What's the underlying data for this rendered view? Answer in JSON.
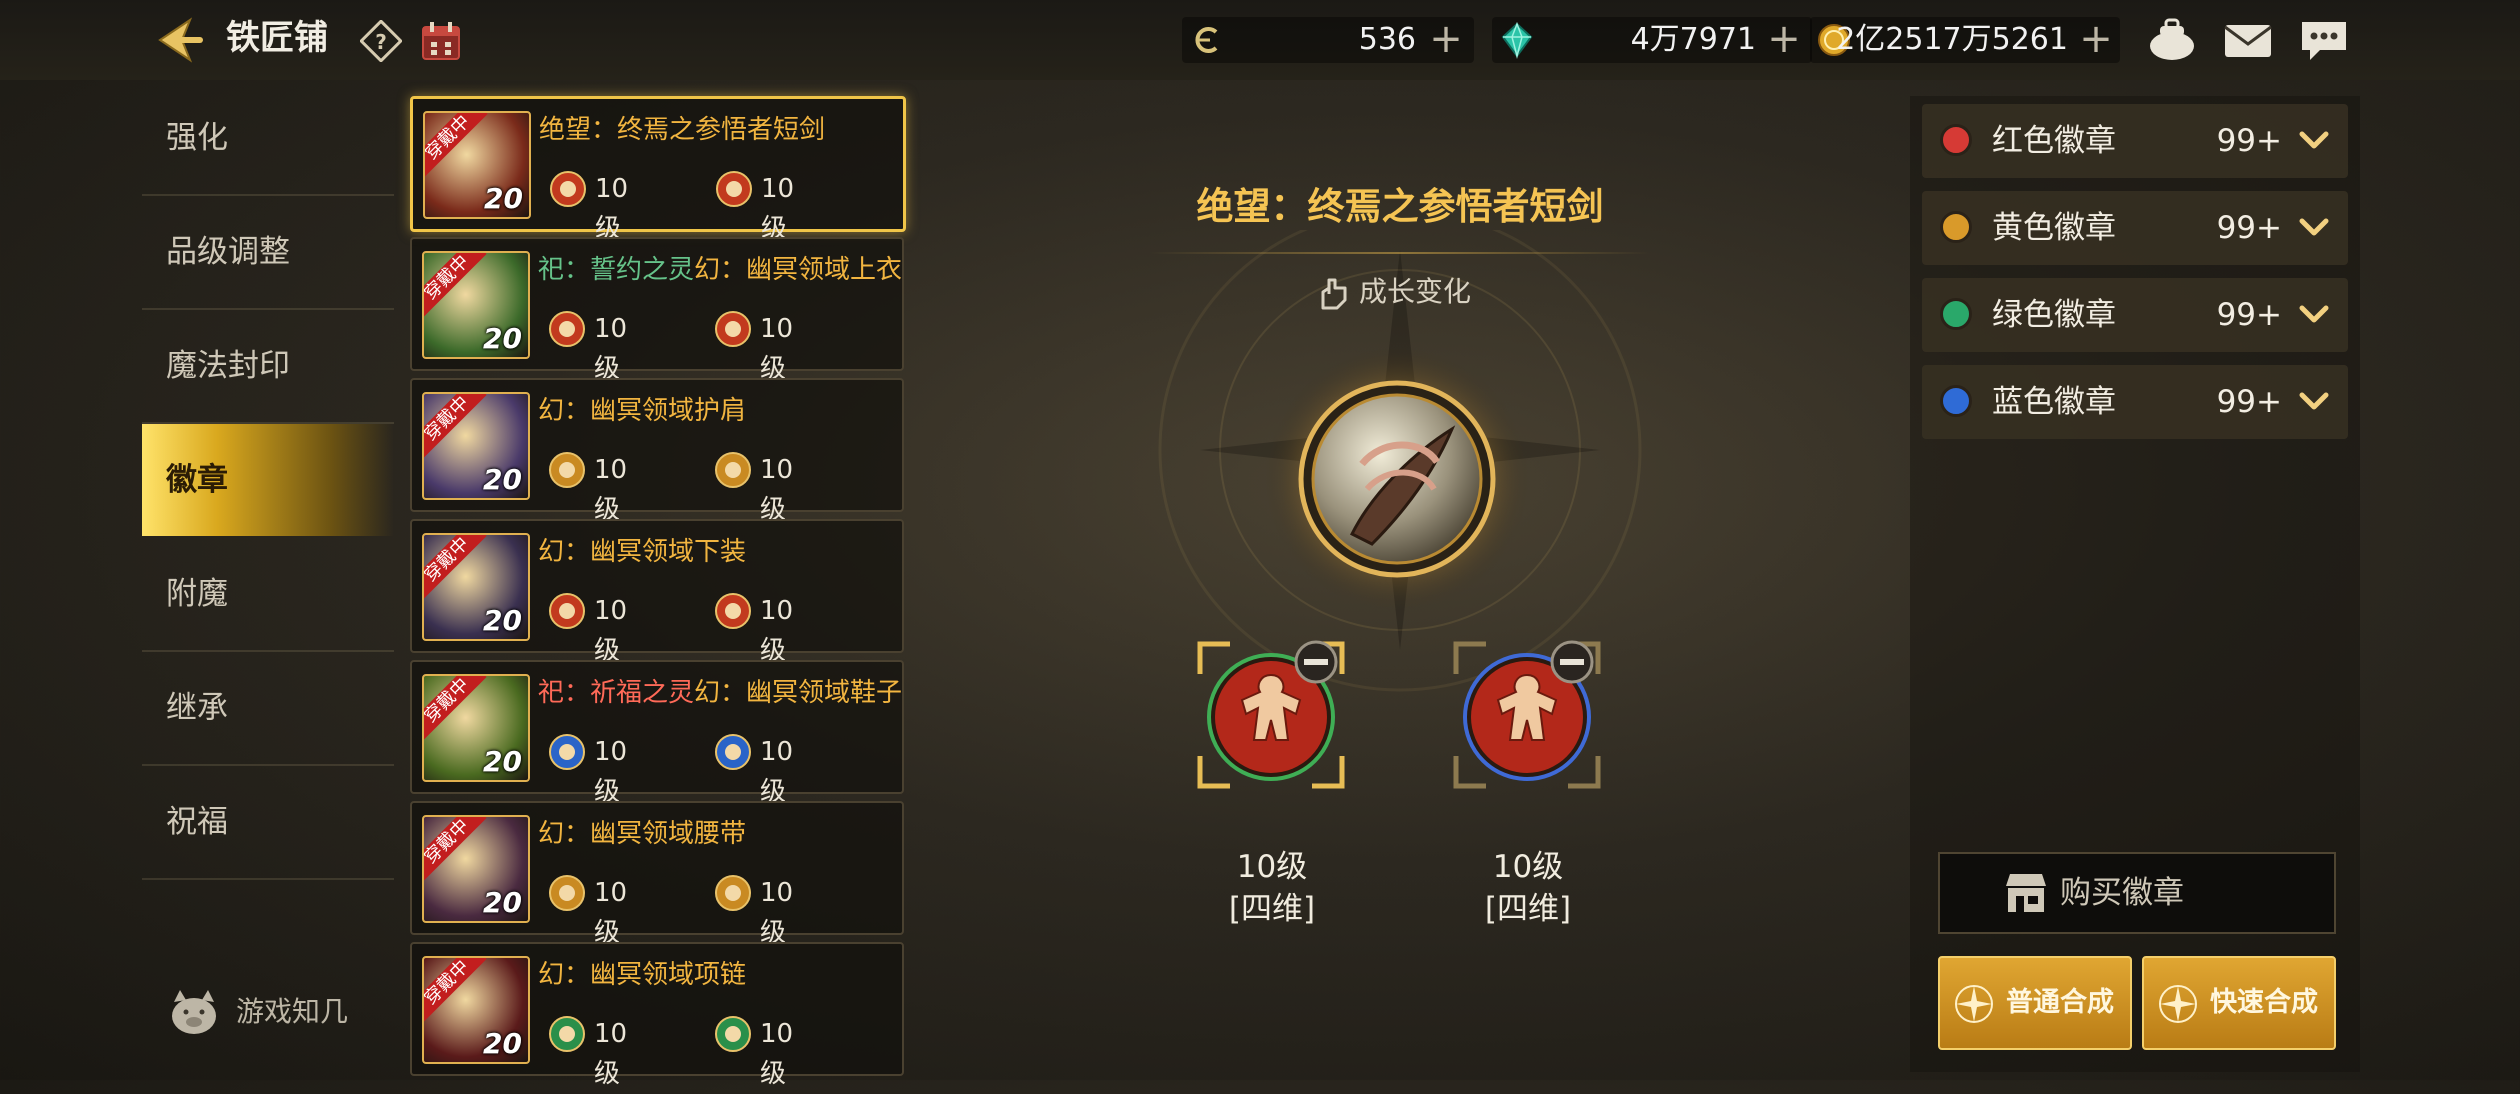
{
  "header": {
    "title": "铁匠铺",
    "currencies": [
      {
        "icon": "coin-c-icon",
        "value": "536"
      },
      {
        "icon": "crystal-icon",
        "value": "4万7971"
      },
      {
        "icon": "gold-coin-icon",
        "value": "2亿2517万5261"
      }
    ]
  },
  "nav": {
    "items": [
      {
        "label": "强化"
      },
      {
        "label": "品级调整"
      },
      {
        "label": "魔法封印"
      },
      {
        "label": "徽章",
        "active": true
      },
      {
        "label": "附魔"
      },
      {
        "label": "继承"
      },
      {
        "label": "祝福"
      }
    ],
    "footer_label": "游戏知几"
  },
  "equipment": [
    {
      "prefix": "",
      "name": "绝望：终焉之参悟者短剑",
      "tag": "穿戴中",
      "level": "20",
      "slot1": "10级",
      "slot2": "10级",
      "emblem": "red",
      "selected": true
    },
    {
      "prefix": "祀：誓约之灵",
      "name": "幻：幽冥领域上衣",
      "tag": "穿戴中",
      "level": "20",
      "slot1": "10级",
      "slot2": "10级",
      "emblem": "red"
    },
    {
      "prefix": "",
      "name": "幻：幽冥领域护肩",
      "tag": "穿戴中",
      "level": "20",
      "slot1": "10级",
      "slot2": "10级",
      "emblem": "yellow"
    },
    {
      "prefix": "",
      "name": "幻：幽冥领域下装",
      "tag": "穿戴中",
      "level": "20",
      "slot1": "10级",
      "slot2": "10级",
      "emblem": "red"
    },
    {
      "prefix": "祀：祈福之灵",
      "name": "幻：幽冥领域鞋子",
      "tag": "穿戴中",
      "level": "20",
      "slot1": "10级",
      "slot2": "10级",
      "emblem": "blue"
    },
    {
      "prefix": "",
      "name": "幻：幽冥领域腰带",
      "tag": "穿戴中",
      "level": "20",
      "slot1": "10级",
      "slot2": "10级",
      "emblem": "yellow"
    },
    {
      "prefix": "",
      "name": "幻：幽冥领域项链",
      "tag": "穿戴中",
      "level": "20",
      "slot1": "10级",
      "slot2": "10级",
      "emblem": "green"
    }
  ],
  "center": {
    "selected_title": "绝望：终焉之参悟者短剑",
    "growth_label": "成长变化",
    "slots": [
      {
        "level": "10级",
        "tag": "[四维]"
      },
      {
        "level": "10级",
        "tag": "[四维]"
      }
    ]
  },
  "badges": {
    "rows": [
      {
        "name": "红色徽章",
        "count": "99+",
        "color": "#d63a35"
      },
      {
        "name": "黄色徽章",
        "count": "99+",
        "color": "#d99a2a"
      },
      {
        "name": "绿色徽章",
        "count": "99+",
        "color": "#2aa86a"
      },
      {
        "name": "蓝色徽章",
        "count": "99+",
        "color": "#2f6bd6"
      }
    ],
    "buy_label": "购买徽章",
    "normal_synth_label": "普通合成",
    "quick_synth_label": "快速合成"
  },
  "colors": {
    "accent_gold": "#f2b540",
    "emblem_red": "#c23a1e",
    "emblem_yellow": "#c98a22",
    "emblem_green": "#2a8f4a",
    "emblem_blue": "#2a64c8"
  }
}
